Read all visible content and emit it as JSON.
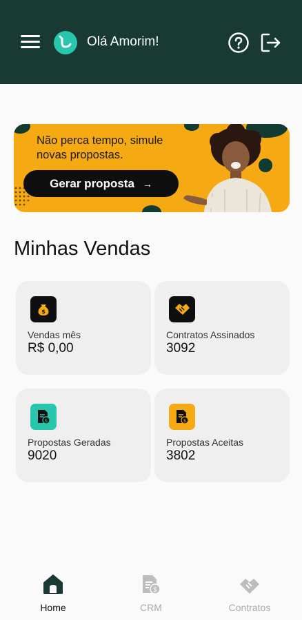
{
  "header": {
    "greeting": "Olá Amorim!",
    "icons": [
      "menu-icon",
      "app-logo",
      "help-icon",
      "logout-icon"
    ],
    "background_color": "#183a32"
  },
  "banner": {
    "text": "Não perca tempo, simule novas propostas.",
    "button_label": "Gerar proposta",
    "button_arrow": "→",
    "background_color": "#f5a913"
  },
  "section": {
    "title": "Minhas Vendas"
  },
  "cards": [
    {
      "label": "Vendas mês",
      "value": "R$ 0,00",
      "icon": "money-bag-icon",
      "icon_color": "#0f0f0f"
    },
    {
      "label": "Contratos Assinados",
      "value": "3092",
      "icon": "handshake-icon",
      "icon_color": "#0f0f0f"
    },
    {
      "label": "Propostas Geradas",
      "value": "9020",
      "icon": "document-money-icon",
      "icon_color": "#27c6ad"
    },
    {
      "label": "Propostas Aceitas",
      "value": "3802",
      "icon": "document-check-icon",
      "icon_color": "#f5a913"
    }
  ],
  "bottom_nav": [
    {
      "label": "Home",
      "icon": "home-icon",
      "active": true
    },
    {
      "label": "CRM",
      "icon": "document-money-icon",
      "active": false
    },
    {
      "label": "Contratos",
      "icon": "handshake-icon",
      "active": false
    }
  ]
}
